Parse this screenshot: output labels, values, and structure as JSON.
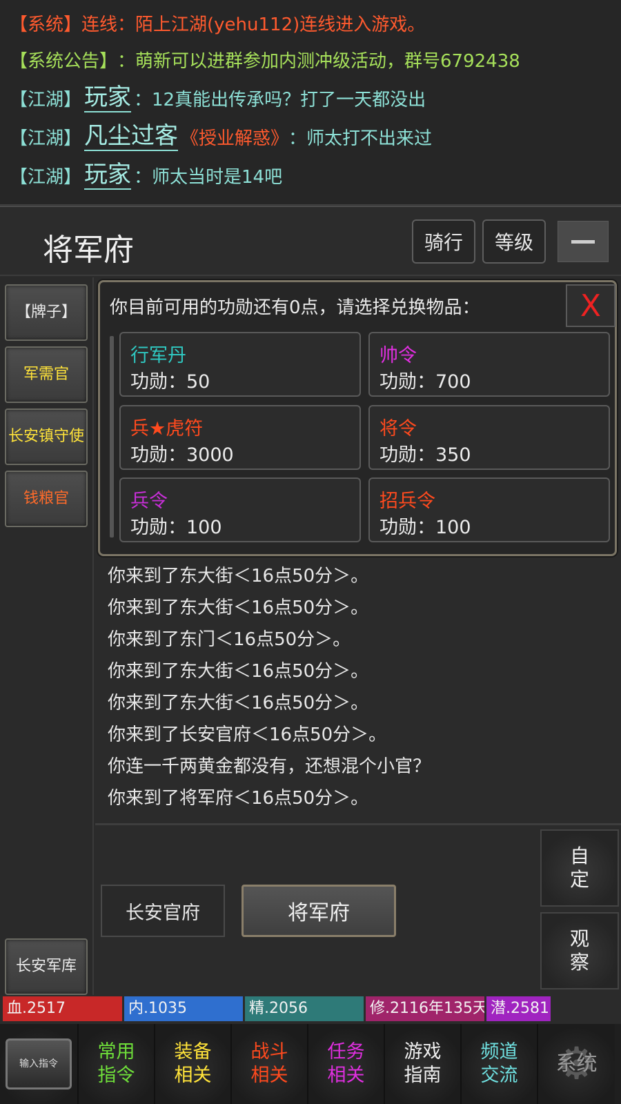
{
  "chat": {
    "lines": [
      {
        "type": "system",
        "tag": "【系统】",
        "text": "连线：陌上江湖(yehu112)连线进入游戏。"
      },
      {
        "type": "announcement",
        "tag": "【系统公告】",
        "text": "：萌新可以进群参加内测冲级活动，群号6792438"
      },
      {
        "type": "jianghu",
        "tag": "【江湖】",
        "player": "玩家",
        "title": "",
        "text": "：12真能出传承吗？打了一天都没出"
      },
      {
        "type": "jianghu",
        "tag": "【江湖】",
        "player": "凡尘过客",
        "title": "《授业解惑》",
        "text": "：师太打不出来过"
      },
      {
        "type": "jianghu",
        "tag": "【江湖】",
        "player": "玩家",
        "title": "",
        "text": "：师太当时是14吧"
      }
    ]
  },
  "header": {
    "location": "将军府",
    "ride_label": "骑行",
    "level_label": "等级"
  },
  "sidebar": {
    "npcs": [
      {
        "label": "【牌子】",
        "color": "plain"
      },
      {
        "label": "军需官",
        "color": "yellow"
      },
      {
        "label": "长安镇守使",
        "color": "yellow"
      },
      {
        "label": "钱粮官",
        "color": "orange"
      }
    ],
    "bottom_npc": "长安军库"
  },
  "dialog": {
    "prompt": "你目前可用的功勋还有0点，请选择兑换物品：",
    "close_label": "X",
    "items": [
      {
        "name": "行军丹",
        "cost": "功勋：50",
        "color": "#2fc9c2"
      },
      {
        "name": "帅令",
        "cost": "功勋：700",
        "color": "#e02fe0"
      },
      {
        "name": "兵★虎符",
        "cost": "功勋：3000",
        "color": "#ff4a1e"
      },
      {
        "name": "将令",
        "cost": "功勋：350",
        "color": "#ff4a1e"
      },
      {
        "name": "兵令",
        "cost": "功勋：100",
        "color": "#c82fd8"
      },
      {
        "name": "招兵令",
        "cost": "功勋：100",
        "color": "#ff4a1e"
      }
    ]
  },
  "messages": [
    "你来到了东大街＜16点50分＞。",
    "你来到了东大街＜16点50分＞。",
    "你来到了东门＜16点50分＞。",
    "你来到了东大街＜16点50分＞。",
    "你来到了东大街＜16点50分＞。",
    "你来到了长安官府＜16点50分＞。",
    "你连一千两黄金都没有，还想混个小官？",
    "你来到了将军府＜16点50分＞。"
  ],
  "exits": [
    "长安官府",
    "将军府"
  ],
  "side_buttons": {
    "custom": "自\n定",
    "observe": "观\n察"
  },
  "status": [
    {
      "label": "血.2517",
      "color": "#c82828"
    },
    {
      "label": "内.1035",
      "color": "#2f6fcf"
    },
    {
      "label": "精.2056",
      "color": "#2e7a78"
    },
    {
      "label": "修.2116年135天",
      "color": "#a0246a"
    },
    {
      "label": "潜.2581",
      "color": "#a024c0"
    }
  ],
  "nav": {
    "input_label": "输入指令",
    "items": [
      {
        "label": "常用\n指令",
        "color": "#6fe03a"
      },
      {
        "label": "装备\n相关",
        "color": "#ffe33a"
      },
      {
        "label": "战斗\n相关",
        "color": "#ff4a1e"
      },
      {
        "label": "任务\n相关",
        "color": "#e02fe0"
      },
      {
        "label": "游戏\n指南",
        "color": "#f0f0f0"
      },
      {
        "label": "频道\n交流",
        "color": "#6fe0e0"
      }
    ],
    "system_label": "系统"
  }
}
